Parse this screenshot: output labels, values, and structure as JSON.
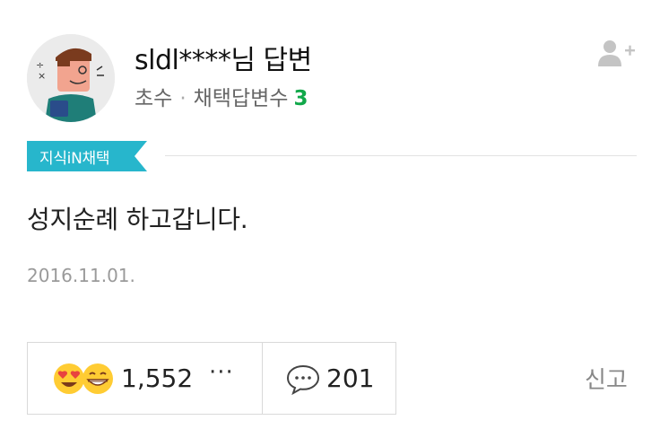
{
  "profile": {
    "username": "sldl****님 답변",
    "sub_label": "초수",
    "separator": "·",
    "adopted_label": "채택답변수",
    "adopted_count": "3"
  },
  "badge": {
    "label": "지식iN채택",
    "color": "#27b6cc"
  },
  "answer": {
    "text": "성지순례 하고갑니다.",
    "date": "2016.11.01."
  },
  "actions": {
    "like_count": "1,552",
    "more_label": "···",
    "comment_count": "201",
    "report_label": "신고"
  },
  "icons": [
    "avatar",
    "follow-icon",
    "heart-eyes-emoji-icon",
    "grin-emoji-icon",
    "more-icon",
    "comment-icon"
  ],
  "colors": {
    "accent_green": "#11a84a",
    "badge": "#27b6cc"
  }
}
